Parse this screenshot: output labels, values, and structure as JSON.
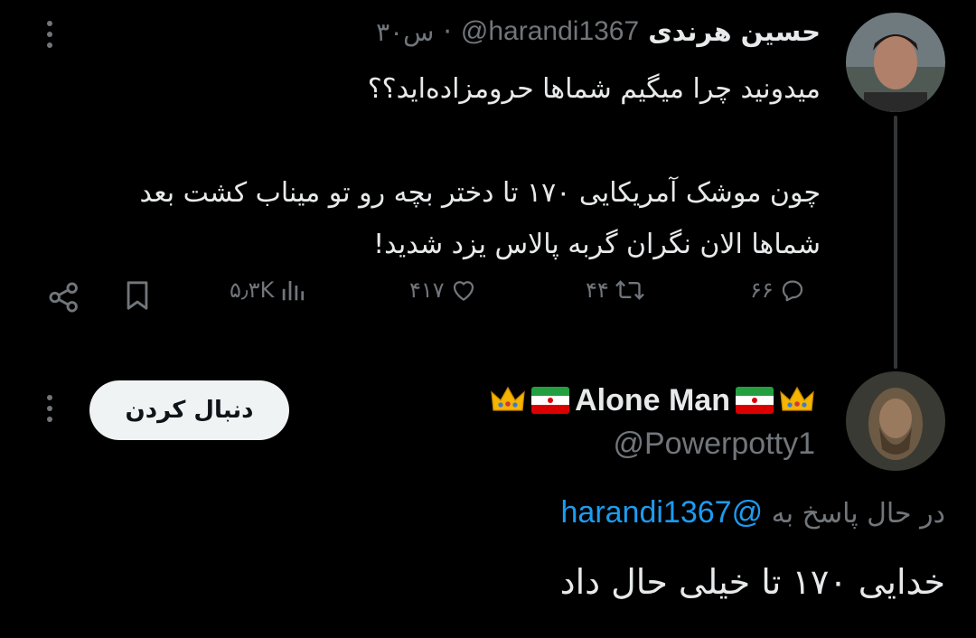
{
  "tweet": {
    "author_name": "حسین هرندی",
    "author_handle": "@harandi1367",
    "separator": "·",
    "time": "۳۰س",
    "body_lines": [
      "میدونید چرا میگیم شماها حرومزاده‌اید؟؟",
      "چون موشک آمریکایی ۱۷۰ تا دختر بچه رو تو میناب کشت بعد",
      "شماها الان نگران گربه پالاس یزد شدید!"
    ],
    "stats": {
      "replies": "۶۶",
      "retweets": "۴۴",
      "likes": "۴۱۷",
      "views": "۵٫۳K"
    }
  },
  "reply": {
    "author_name": "Alone Man",
    "author_handle": "@Powerpotty1",
    "follow_label": "دنبال کردن",
    "replying_to_prefix": "در حال پاسخ به",
    "replying_to_handle": "@harandi1367",
    "body": "خدایی ۱۷۰ تا خیلی حال داد",
    "decorations": [
      "crown-emoji",
      "iran-flag-emoji",
      "iran-flag-emoji",
      "crown-emoji"
    ]
  },
  "colors": {
    "background": "#000000",
    "text": "#e7e9ea",
    "muted": "#71767b",
    "link": "#1d9bf0",
    "button_bg": "#eff3f4"
  }
}
